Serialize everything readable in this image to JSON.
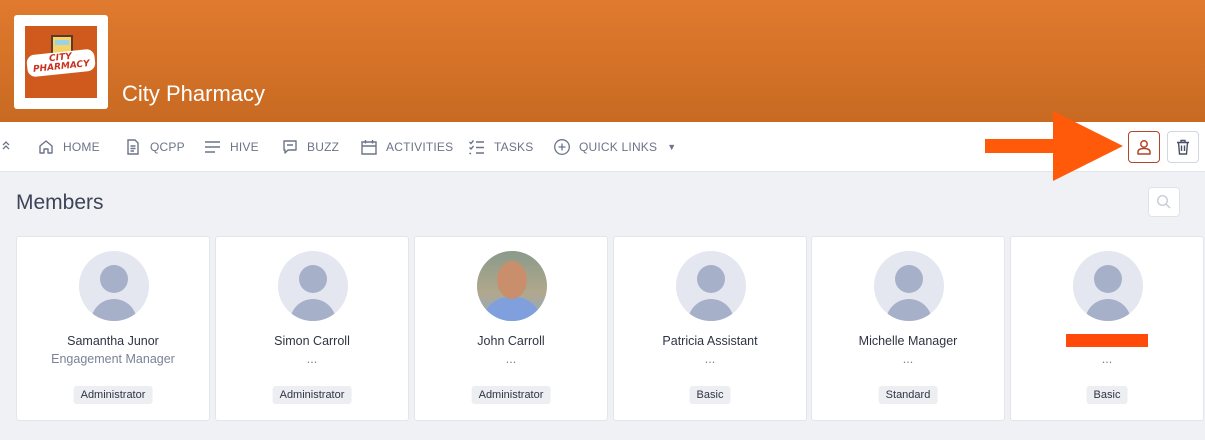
{
  "brand": {
    "name": "City Pharmacy",
    "logo_text": "CITY PHARMACY"
  },
  "nav": {
    "collapse_icon": "double-chevron-up-icon",
    "items": [
      {
        "label": "HOME",
        "icon": "home-icon"
      },
      {
        "label": "QCPP",
        "icon": "document-icon"
      },
      {
        "label": "HIVE",
        "icon": "lines-icon"
      },
      {
        "label": "BUZZ",
        "icon": "chat-icon"
      },
      {
        "label": "ACTIVITIES",
        "icon": "calendar-icon"
      },
      {
        "label": "TASKS",
        "icon": "checklist-icon"
      },
      {
        "label": "QUICK LINKS",
        "icon": "plus-circle-icon",
        "dropdown": true
      }
    ]
  },
  "toolbar": {
    "user_icon": "user-icon",
    "trash_icon": "trash-icon",
    "accent": "#b2442a",
    "arrow_color": "#ff5a0a"
  },
  "members": {
    "title": "Members",
    "search_icon": "search-icon",
    "cards": [
      {
        "name": "Samantha Junor",
        "subtitle": "Engagement Manager",
        "role": "Administrator"
      },
      {
        "name": "Simon Carroll",
        "subtitle": "...",
        "role": "Administrator"
      },
      {
        "name": "John Carroll",
        "subtitle": "...",
        "role": "Administrator"
      },
      {
        "name": "Patricia Assistant",
        "subtitle": "...",
        "role": "Basic"
      },
      {
        "name": "Michelle Manager",
        "subtitle": "...",
        "role": "Standard"
      },
      {
        "name": "",
        "subtitle": "...",
        "role": "Basic"
      }
    ]
  },
  "colors": {
    "banner": "#d8722a",
    "background": "#f0f1f5"
  }
}
